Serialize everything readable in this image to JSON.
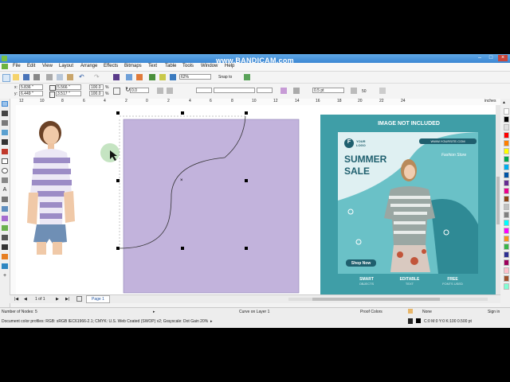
{
  "watermark": "www.BANDICAM.com",
  "menu": [
    "File",
    "Edit",
    "View",
    "Layout",
    "Arrange",
    "Effects",
    "Bitmaps",
    "Text",
    "Table",
    "Tools",
    "Window",
    "Help"
  ],
  "toolbar": {
    "zoom": "62%",
    "snap_label": "Snap to"
  },
  "propbar": {
    "x_label": "x:",
    "x_value": "5.836 \"",
    "y_label": "y:",
    "y_value": "6.449 \"",
    "w_value": "5.566 \"",
    "h_value": "3.517 \"",
    "scale_x": "100.0",
    "scale_y": "100.0",
    "pct": "%",
    "rotation": "0.0",
    "outline_width": "0.5 pt",
    "smoothing": "50"
  },
  "ruler_unit": "inches",
  "ruler_top_ticks": [
    "12",
    "10",
    "8",
    "6",
    "4",
    "2",
    "0",
    "2",
    "4",
    "6",
    "8",
    "10",
    "12",
    "14",
    "16",
    "18",
    "20",
    "22",
    "24"
  ],
  "page_nav": {
    "count": "1 of 1",
    "tab": "Page 1"
  },
  "artwork": {
    "banner": "IMAGE NOT INCLUDED",
    "logo_letter": "F",
    "logo_line1": "YOUR",
    "logo_line2": "LOGO",
    "website": "WWW.YOURSITE.COM",
    "headline1": "SUMMER",
    "headline2": "SALE",
    "store": "Fashion Store",
    "cta": "Shop Now",
    "features": [
      {
        "title": "SMART",
        "sub": "OBJECTS"
      },
      {
        "title": "EDITABLE",
        "sub": "TEXT"
      },
      {
        "title": "FREE",
        "sub": "FONTS USED"
      }
    ]
  },
  "status": {
    "nodes": "Number of Nodes: 5",
    "object": "Curve on Layer 1",
    "proof": "Proof Colors",
    "fill": "None",
    "profiles": "Document color profiles: RGB: sRGB IEC61966-2.1; CMYK: U.S. Web Coated (SWOP) v2; Grayscale: Dot Gain 20%",
    "outline": "C:0 M:0 Y:0 K:100  0.500 pt",
    "signin": "Sign in"
  },
  "colors": {
    "purple_rect": "#c2b3dc",
    "teal": "#3f9ea7",
    "teal_dark": "#1f5f6e",
    "title_bar": "#3b86d3"
  },
  "palette": [
    "#ffffff",
    "#000000",
    "#e0e0e0",
    "#ff0000",
    "#ff7f00",
    "#ffff00",
    "#00a651",
    "#00aeef",
    "#0054a6",
    "#662d91",
    "#ec008c",
    "#8b4513",
    "#c0c0c0",
    "#808080",
    "#00ffff",
    "#ff00ff",
    "#f7941d",
    "#39b54a",
    "#2e3192",
    "#9e005d",
    "#ffc0cb",
    "#a0522d",
    "#7fffd4"
  ]
}
